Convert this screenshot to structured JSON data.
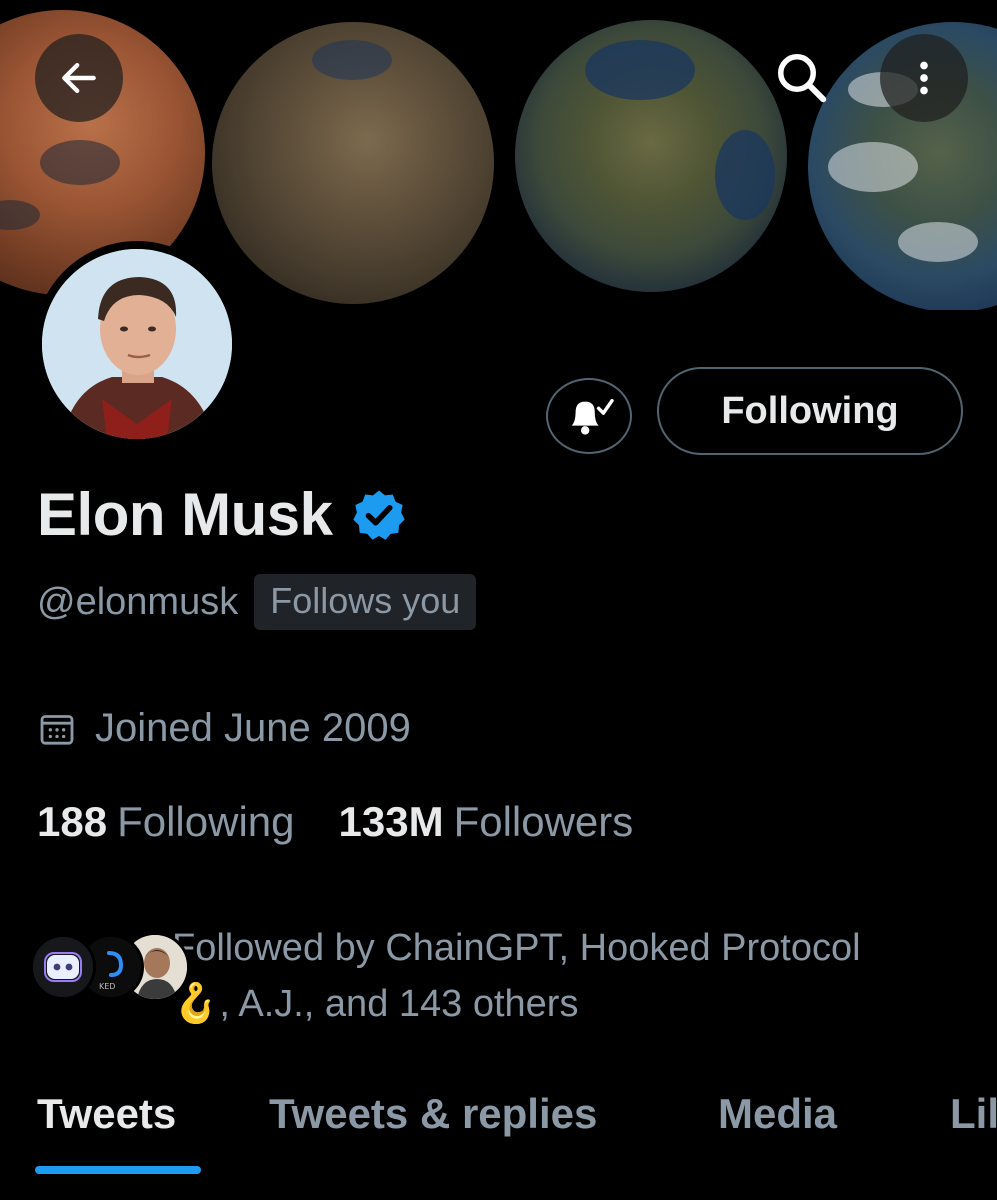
{
  "header": {
    "back_icon": "back-arrow-icon",
    "search_icon": "search-icon",
    "more_icon": "more-vertical-icon"
  },
  "profile": {
    "name": "Elon Musk",
    "handle": "@elonmusk",
    "follows_you": "Follows you",
    "verified": true,
    "joined": "Joined June 2009",
    "following_count": "188",
    "following_label": "Following",
    "followers_count": "133M",
    "followers_label": "Followers",
    "followed_by_line1": "Followed by ChainGPT, Hooked Protocol",
    "followed_by_emoji": "🪝",
    "followed_by_line2": ", A.J., and 143 others",
    "mini_avatar_label": "KED"
  },
  "actions": {
    "bell_icon": "notification-bell-check-icon",
    "following_button": "Following"
  },
  "tabs": [
    {
      "label": "Tweets",
      "active": true
    },
    {
      "label": "Tweets & replies",
      "active": false
    },
    {
      "label": "Media",
      "active": false
    },
    {
      "label": "Lil",
      "active": false
    }
  ],
  "colors": {
    "background": "#000000",
    "text_primary": "#e7e9ea",
    "text_secondary": "#8b98a5",
    "accent": "#1d9bf0",
    "border": "#536471"
  }
}
